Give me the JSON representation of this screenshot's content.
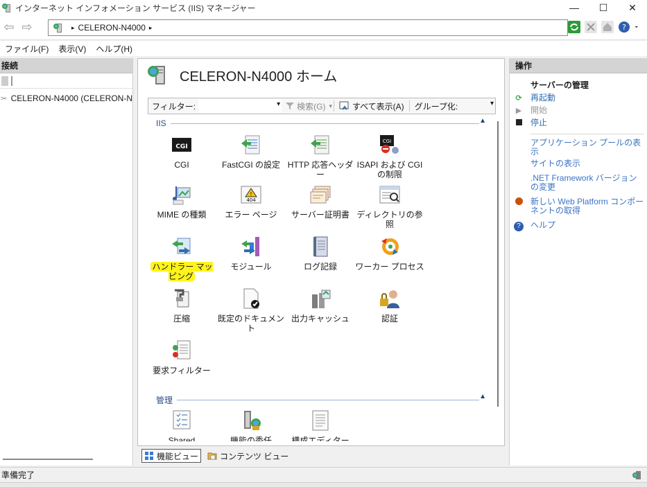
{
  "window": {
    "title": "インターネット インフォメーション サービス (IIS) マネージャー",
    "minimize": "—",
    "maximize": "☐",
    "close": "✕"
  },
  "address": {
    "crumb": "CELERON-N4000",
    "separator": "▸"
  },
  "menu": [
    "ファイル(F)",
    "表示(V)",
    "ヘルプ(H)"
  ],
  "connections": {
    "header": "接続",
    "tree_item": "CELERON-N4000 (CELERON-N"
  },
  "center": {
    "title": "CELERON-N4000 ホーム",
    "filter_label": "フィルター:",
    "search_btn": "検索(G)",
    "show_all_btn": "すべて表示(A)",
    "group_label": "グループ化:",
    "group_iis": "IIS",
    "group_manage": "管理",
    "features": [
      {
        "label": "CGI",
        "icon": "cgi-icon"
      },
      {
        "label": "FastCGI の設定",
        "icon": "fastcgi-icon"
      },
      {
        "label": "HTTP 応答ヘッダー",
        "icon": "http-response-headers-icon"
      },
      {
        "label": "ISAPI および CGI の制限",
        "icon": "isapi-cgi-restrictions-icon"
      },
      {
        "label": "MIME の種類",
        "icon": "mime-types-icon"
      },
      {
        "label": "エラー ページ",
        "icon": "error-pages-icon"
      },
      {
        "label": "サーバー証明書",
        "icon": "server-certificates-icon"
      },
      {
        "label": "ディレクトリの参照",
        "icon": "directory-browsing-icon"
      },
      {
        "label": "ハンドラー マッピング",
        "icon": "handler-mappings-icon"
      },
      {
        "label": "モジュール",
        "icon": "modules-icon"
      },
      {
        "label": "ログ記録",
        "icon": "logging-icon"
      },
      {
        "label": "ワーカー プロセス",
        "icon": "worker-processes-icon"
      },
      {
        "label": "圧縮",
        "icon": "compression-icon"
      },
      {
        "label": "既定のドキュメント",
        "icon": "default-document-icon"
      },
      {
        "label": "出力キャッシュ",
        "icon": "output-caching-icon"
      },
      {
        "label": "認証",
        "icon": "authentication-icon"
      },
      {
        "label": "要求フィルター",
        "icon": "request-filtering-icon"
      }
    ],
    "manage_features": [
      {
        "label": "Shared",
        "icon": "shared-configuration-icon"
      },
      {
        "label": "機能の委任",
        "icon": "feature-delegation-icon"
      },
      {
        "label": "構成エディター",
        "icon": "configuration-editor-icon"
      }
    ]
  },
  "views": {
    "features_view": "機能ビュー",
    "content_view": "コンテンツ ビュー"
  },
  "actions": {
    "header": "操作",
    "server_manage": "サーバーの管理",
    "restart": "再起動",
    "start": "開始",
    "stop": "停止",
    "view_app_pools": "アプリケーション プールの表示",
    "view_sites": "サイトの表示",
    "change_framework": ".NET Framework バージョンの変更",
    "get_web_platform": "新しい Web Platform コンポーネントの取得",
    "help": "ヘルプ"
  },
  "status": {
    "text": "準備完了"
  },
  "colors": {
    "link": "#2f6fb3",
    "highlight": "#fff41a",
    "panel_header": "#d4d4d4"
  }
}
